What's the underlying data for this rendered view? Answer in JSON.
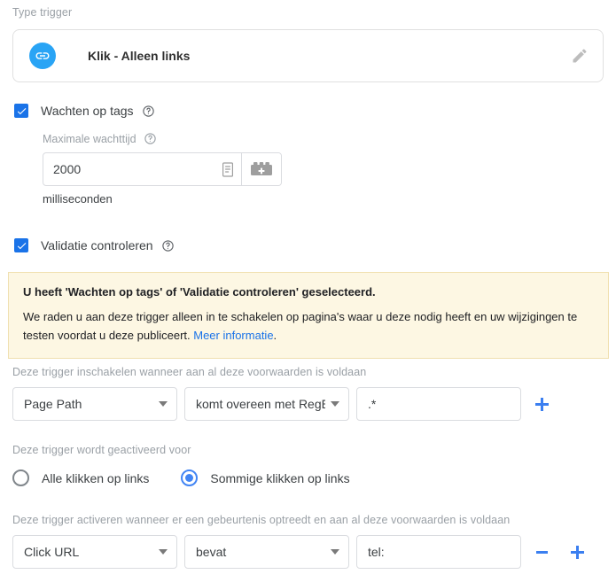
{
  "trigger_type": {
    "label": "Type trigger",
    "icon": "link-icon",
    "name": "Klik - Alleen links",
    "edit_icon": "pencil-icon"
  },
  "wait_for_tags": {
    "label": "Wachten op tags",
    "checked": true,
    "help_icon": "help-circle-icon",
    "max_wait": {
      "label": "Maximale wachttijd",
      "help_icon": "help-circle-icon",
      "value": "2000",
      "value_icon": "document-icon",
      "variable_button_icon": "variable-block-icon",
      "unit": "milliseconden"
    }
  },
  "check_validation": {
    "label": "Validatie controleren",
    "checked": true,
    "help_icon": "help-circle-icon"
  },
  "warning": {
    "title": "U heeft 'Wachten op tags' of 'Validatie controleren' geselecteerd.",
    "body_before_link": "We raden u aan deze trigger alleen in te schakelen op pagina's waar u deze nodig heeft en uw wijzigingen te testen voordat u deze publiceert. ",
    "link_text": "Meer informatie",
    "body_after_link": ".",
    "background_color": "#fdf7e3",
    "border_color": "#f0e0b0",
    "link_color": "#1a73e8"
  },
  "enable_conditions": {
    "label": "Deze trigger inschakelen wanneer aan al deze voorwaarden is voldaan",
    "rows": [
      {
        "variable": "Page Path",
        "operator": "komt overeen met RegEx",
        "value": ".*",
        "add_button": "+"
      }
    ]
  },
  "fires_on": {
    "label": "Deze trigger wordt geactiveerd voor",
    "options": [
      {
        "label": "Alle klikken op links",
        "selected": false
      },
      {
        "label": "Sommige klikken op links",
        "selected": true
      }
    ]
  },
  "fire_conditions": {
    "label": "Deze trigger activeren wanneer er een gebeurtenis optreedt en aan al deze voorwaarden is voldaan",
    "rows": [
      {
        "variable": "Click URL",
        "operator": "bevat",
        "value": "tel:",
        "remove_button": "−",
        "add_button": "+"
      }
    ]
  },
  "colors": {
    "accent_blue": "#1a73e8",
    "plus_blue": "#3b7ff0",
    "badge_blue": "#29a4f5",
    "radio_blue": "#4285f4",
    "label_gray": "#9aa0a6",
    "border_gray": "#dadce0"
  }
}
